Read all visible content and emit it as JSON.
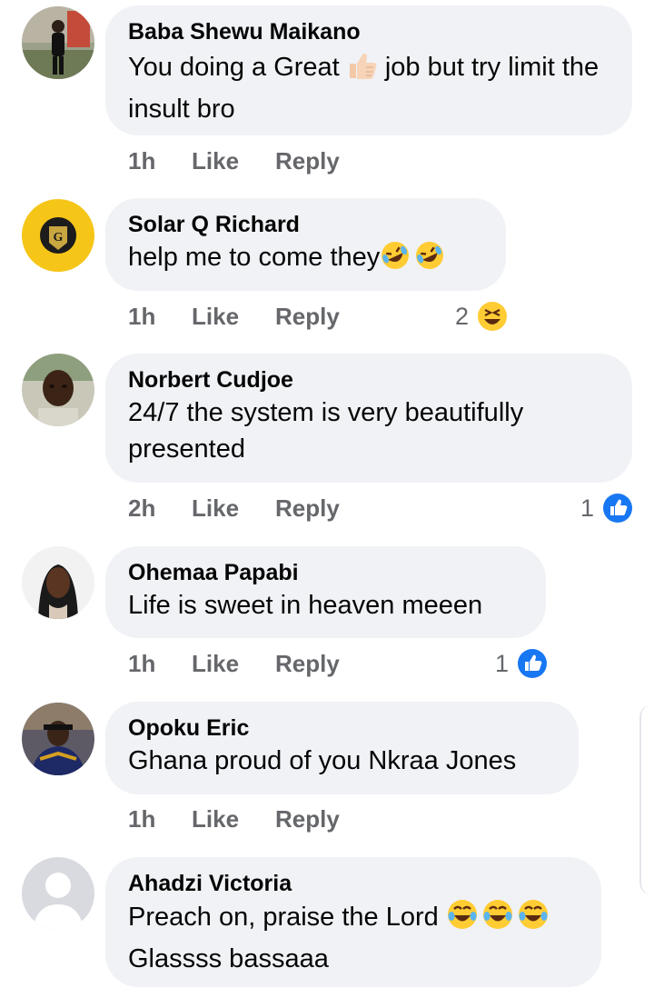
{
  "comments": [
    {
      "author": "Baba Shewu Maikano",
      "text_before": "You doing a Great ",
      "text_after": " job but try limit the insult bro",
      "time": "1h",
      "like": "Like",
      "reply": "Reply"
    },
    {
      "author": "Solar Q Richard",
      "text": "help me to come they",
      "time": "1h",
      "like": "Like",
      "reply": "Reply",
      "reaction_count": "2",
      "reaction_icon": "laughing-squint-icon"
    },
    {
      "author": "Norbert Cudjoe",
      "text": "24/7 the system is very beautifully presented",
      "time": "2h",
      "like": "Like",
      "reply": "Reply",
      "reaction_count": "1",
      "reaction_icon": "like-thumb-icon"
    },
    {
      "author": "Ohemaa Papabi",
      "text": "Life is sweet in heaven meeen",
      "time": "1h",
      "like": "Like",
      "reply": "Reply",
      "reaction_count": "1",
      "reaction_icon": "like-thumb-icon"
    },
    {
      "author": "Opoku Eric",
      "text": "Ghana proud of you Nkraa Jones",
      "time": "1h",
      "like": "Like",
      "reply": "Reply"
    },
    {
      "author": "Ahadzi Victoria",
      "text_line1": "Preach on, praise the Lord ",
      "text_line2": "Glassss bassaaa"
    }
  ],
  "colors": {
    "bubble": "#f0f2f5",
    "meta": "#65676b",
    "like_blue": "#1877f2",
    "emoji_yellow": "#ffcc33"
  }
}
